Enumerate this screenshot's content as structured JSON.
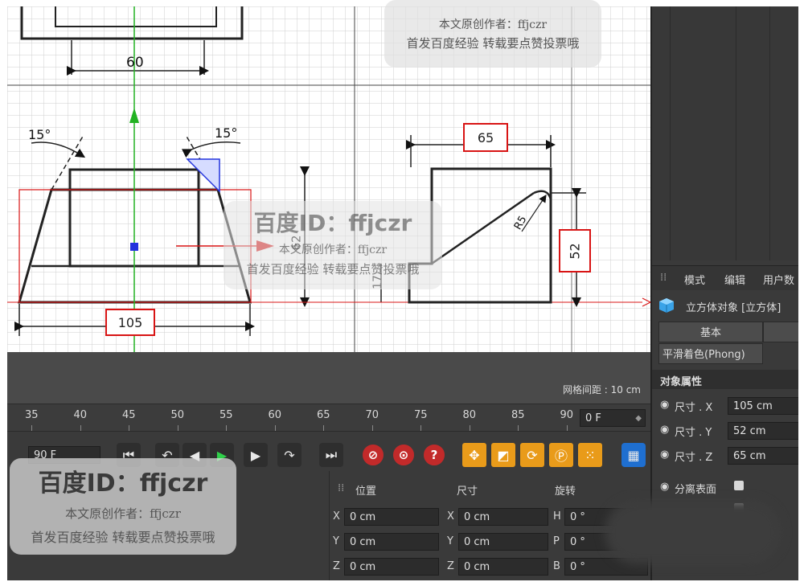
{
  "drawing": {
    "left_view": {
      "dim_top": "60",
      "angle_left": "15°",
      "angle_right": "15°",
      "dim_height": "62",
      "dim_small": "17",
      "dim_bottom": "105"
    },
    "right_view": {
      "dim_top": "65",
      "dim_radius": "R5",
      "dim_right": "52"
    }
  },
  "viewport": {
    "grid_spacing": "网格间距 : 10 cm"
  },
  "timeline": {
    "ticks": [
      "35",
      "40",
      "45",
      "50",
      "55",
      "60",
      "65",
      "70",
      "75",
      "80",
      "85",
      "90"
    ],
    "current_frame": "0 F"
  },
  "controls": {
    "end_frame": "90 F"
  },
  "coordinates": {
    "headers": {
      "position": "位置",
      "size": "尺寸",
      "rotation": "旋转"
    },
    "rows": [
      {
        "pos_axis": "X",
        "pos": "0 cm",
        "size_axis": "X",
        "size": "0 cm",
        "rot_axis": "H",
        "rot": "0 °"
      },
      {
        "pos_axis": "Y",
        "pos": "0 cm",
        "size_axis": "Y",
        "size": "0 cm",
        "rot_axis": "P",
        "rot": "0 °"
      },
      {
        "pos_axis": "Z",
        "pos": "0 cm",
        "size_axis": "Z",
        "size": "0 cm",
        "rot_axis": "B",
        "rot": "0 °"
      }
    ]
  },
  "attributes": {
    "menu": [
      "模式",
      "编辑",
      "用户数"
    ],
    "object_title": "立方体对象 [立方体]",
    "tabs": [
      "基本",
      "平滑着色(Phong)"
    ],
    "section": "对象属性",
    "size_x_label": "尺寸 . X",
    "size_x": "105 cm",
    "size_y_label": "尺寸 . Y",
    "size_y": "52 cm",
    "size_z_label": "尺寸 . Z",
    "size_z": "65 cm",
    "separate_surfaces": "分离表面"
  },
  "watermarks": {
    "id_text": "百度ID：ffjczr",
    "author": "本文原创作者：ffjczr",
    "slogan": "首发百度经验 转载要点赞投票哦"
  },
  "colors": {
    "accent_red": "#d81414",
    "axis_green": "#22b222",
    "axis_blue": "#2233dd",
    "orange_button": "#e99b1a"
  }
}
